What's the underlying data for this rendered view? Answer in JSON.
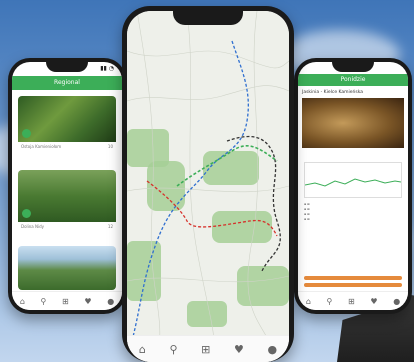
{
  "colors": {
    "accent": "#3cae58",
    "route_red": "#d6312b",
    "route_blue": "#2f6fd0",
    "orange": "#e58a3c"
  },
  "left_phone": {
    "header_title": "Regional",
    "cards": [
      {
        "caption": "Ostoja Kamieniołom",
        "meta": "10"
      },
      {
        "caption": "Dolina Nidy",
        "meta": "12"
      },
      {
        "caption": "",
        "meta": ""
      }
    ],
    "tabs": [
      "home-icon",
      "search-icon",
      "add-icon",
      "heart-icon",
      "user-icon"
    ]
  },
  "center_phone": {
    "tabs": [
      "home-icon",
      "search-icon",
      "add-icon",
      "heart-icon",
      "user-icon"
    ]
  },
  "right_phone": {
    "header_title": "Ponidzie",
    "place_title": "Jaskinia - Kielce Kamieńska",
    "tabs": [
      "home-icon",
      "search-icon",
      "add-icon",
      "heart-icon",
      "user-icon"
    ]
  }
}
